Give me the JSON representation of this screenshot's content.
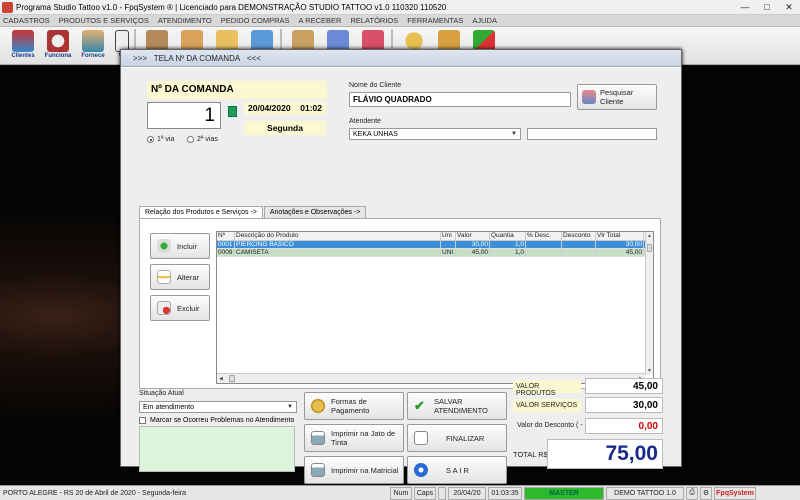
{
  "window": {
    "title": "Programa Studio Tattoo v1.0 - FpqSystem ® | Licenciado para  DEMONSTRAÇÃO STUDIO TATTOO v1.0 110320 110520",
    "minimize": "—",
    "maximize": "□",
    "close": "✕"
  },
  "menu": [
    "CADASTROS",
    "PRODUTOS E SERVIÇOS",
    "ATENDIMENTO",
    "PEDIDO COMPRAS",
    "A RECEBER",
    "RELATÓRIOS",
    "FERRAMENTAS",
    "AJUDA"
  ],
  "toolbar": {
    "clientes": "Clientes",
    "funciona": "Funciona",
    "fornece": "Fornece",
    "cut": "Ve"
  },
  "dialog": {
    "title_prefix": ">>>",
    "title": "TELA Nº DA COMANDA",
    "title_suffix": "<<<",
    "comanda_label": "Nº DA COMANDA",
    "comanda_number": "1",
    "date": "20/04/2020",
    "time": "01:02",
    "weekday": "Segunda",
    "via1": "1ª via",
    "via2": "2ª vias",
    "cliente_label": "Nome do Cliente",
    "cliente_value": "FLÁVIO QUADRADO",
    "pesquisar_cliente": "Pesquisar Cliente",
    "atendente_label": "Atendente",
    "atendente_value": "KEKA UNHAS",
    "tab1": "Relação dos Produtos e Serviços ->",
    "tab2": "Anotações e Observações ->",
    "btn_incluir": "Incluir",
    "btn_alterar": "Alterar",
    "btn_excluir": "Excluir",
    "grid": {
      "headers": [
        "Nº",
        "Descrição do Produto",
        "Uni",
        "Valor",
        "Quantia",
        "% Desc.",
        "Desconto",
        "Vlr Total"
      ],
      "rows": [
        [
          "0001",
          "PIERCING BÁSICO",
          "",
          "30,00",
          "1,0",
          "",
          "",
          "30,00"
        ],
        [
          "0009",
          "CAMISETA",
          "UNI",
          "45,00",
          "1,0",
          "",
          "",
          "45,00"
        ]
      ]
    },
    "situacao_label": "Situação Atual",
    "situacao_value": "Em atendimento",
    "problemas_label": "Marcar se Ocorreu Problemas no Atendimento",
    "btn_formas_pagamento": "Formas de Pagamento",
    "btn_salvar": "SALVAR  ATENDIMENTO",
    "btn_imprimir_jato": "Imprimir na Jato de Tinta",
    "btn_finalizar": "FINALIZAR",
    "btn_imprimir_matricial": "Imprimir na Matricial",
    "btn_sair": "S A I R",
    "valor_produtos_label": "VALOR PRODUTOS",
    "valor_produtos": "45,00",
    "valor_servicos_label": "VALOR SERVIÇOS",
    "valor_servicos": "30,00",
    "desconto_label": "Valor do Desconto ( - )",
    "desconto": "0,00",
    "total_label": "TOTAL R$",
    "total": "75,00"
  },
  "statusbar": {
    "location": "PORTO ALEGRE - RS 20 de Abril de 2020 - Segunda-feira",
    "num": "Num",
    "caps": "Caps",
    "date": "20/04/20",
    "time": "01:03:35",
    "master": "MASTER",
    "version": "DEMO TATTOO 1.0",
    "brand": "FpqSystem"
  }
}
